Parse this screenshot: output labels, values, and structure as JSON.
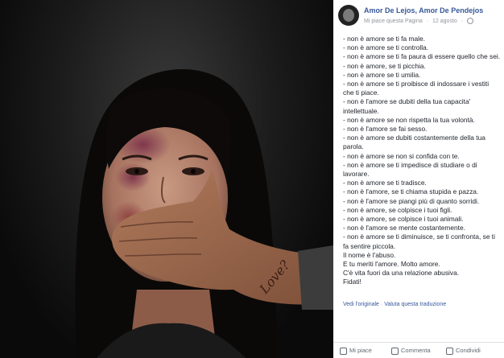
{
  "page": {
    "name": "Amor De Lejos, Amor De Pendejos",
    "meta_liked": "Mi piace questa Pagina",
    "meta_date": "12 agosto"
  },
  "photo": {
    "wrist_text": "Love?"
  },
  "post_lines": [
    "- non è amore se ti fa male.",
    "- non è amore se ti controlla.",
    "- non è amore se ti fa paura di essere quello che sei.",
    "- non è amore, se ti picchia.",
    "- non è amore se ti umilia.",
    "- non è amore se ti proibisce di indossare i vestiti che ti piace.",
    "- non è l'amore se dubiti della tua capacita' intellettuale.",
    "- non è amore se non rispetta la tua volontà.",
    "- non è l'amore se fai sesso.",
    "- non è amore se dubiti costantemente della tua parola.",
    "- non è amore se non si confida con te.",
    "- non è amore se ti impedisce di studiare o di lavorare.",
    "- non è amore se ti tradisce.",
    "- non è l'amore, se ti chiama stupida e pazza.",
    "- non è l'amore se piangi più di quanto sorridi.",
    "- non è amore, se colpisce i tuoi figli.",
    "- non è amore, se colpisce i tuoi animali.",
    "- non è l'amore se mente costantemente.",
    "- non è amore se ti diminuisce, se ti confronta, se ti fa sentire piccola.",
    "Il nome è l'abuso.",
    "E tu meriti l'amore. Molto amore.",
    "C'è vita fuori da una relazione abusiva.",
    "Fidati!"
  ],
  "translation": {
    "see_original": "Vedi l'originale",
    "separator": "·",
    "rate": "Valuta questa traduzione"
  },
  "actions": {
    "like": "Mi piace",
    "comment": "Commenta",
    "share": "Condividi"
  },
  "colors": {
    "link": "#365899",
    "meta": "#90949c",
    "text": "#1d2129"
  }
}
